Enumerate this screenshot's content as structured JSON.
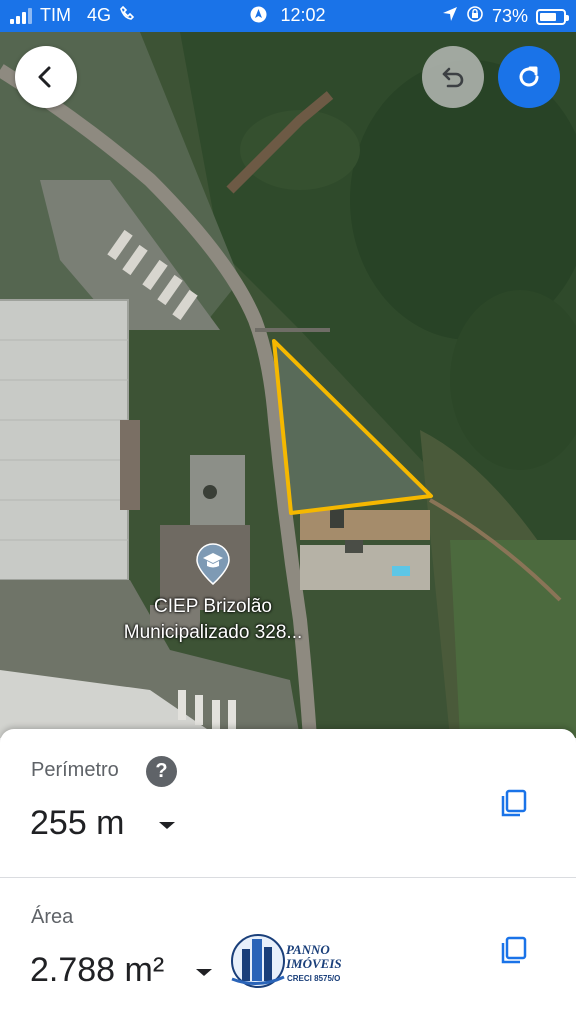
{
  "status_bar": {
    "carrier": "TIM",
    "network": "4G",
    "time": "12:02",
    "battery": "73%",
    "battery_level": 0.73
  },
  "map": {
    "poi_label_line1": "CIEP Brizolão",
    "poi_label_line2": "Municipalizado 328...",
    "polygon_color": "#f5b800"
  },
  "measurement": {
    "perimeter_label": "Perímetro",
    "perimeter_value": "255 m",
    "area_label": "Área",
    "area_value": "2.788 m²",
    "help_symbol": "?"
  },
  "logo": {
    "name_line1": "PANNO",
    "name_line2": "IMÓVEIS",
    "creci": "CRECI 8575/O"
  },
  "colors": {
    "accent": "#1a73e8",
    "text_primary": "#202124",
    "text_secondary": "#5f6368"
  },
  "icons": {
    "back": "arrow-left-icon",
    "undo": "undo-icon",
    "redo": "redo-icon",
    "help": "help-icon",
    "copy": "copy-icon",
    "dropdown": "caret-down-icon",
    "poi": "school-icon"
  }
}
